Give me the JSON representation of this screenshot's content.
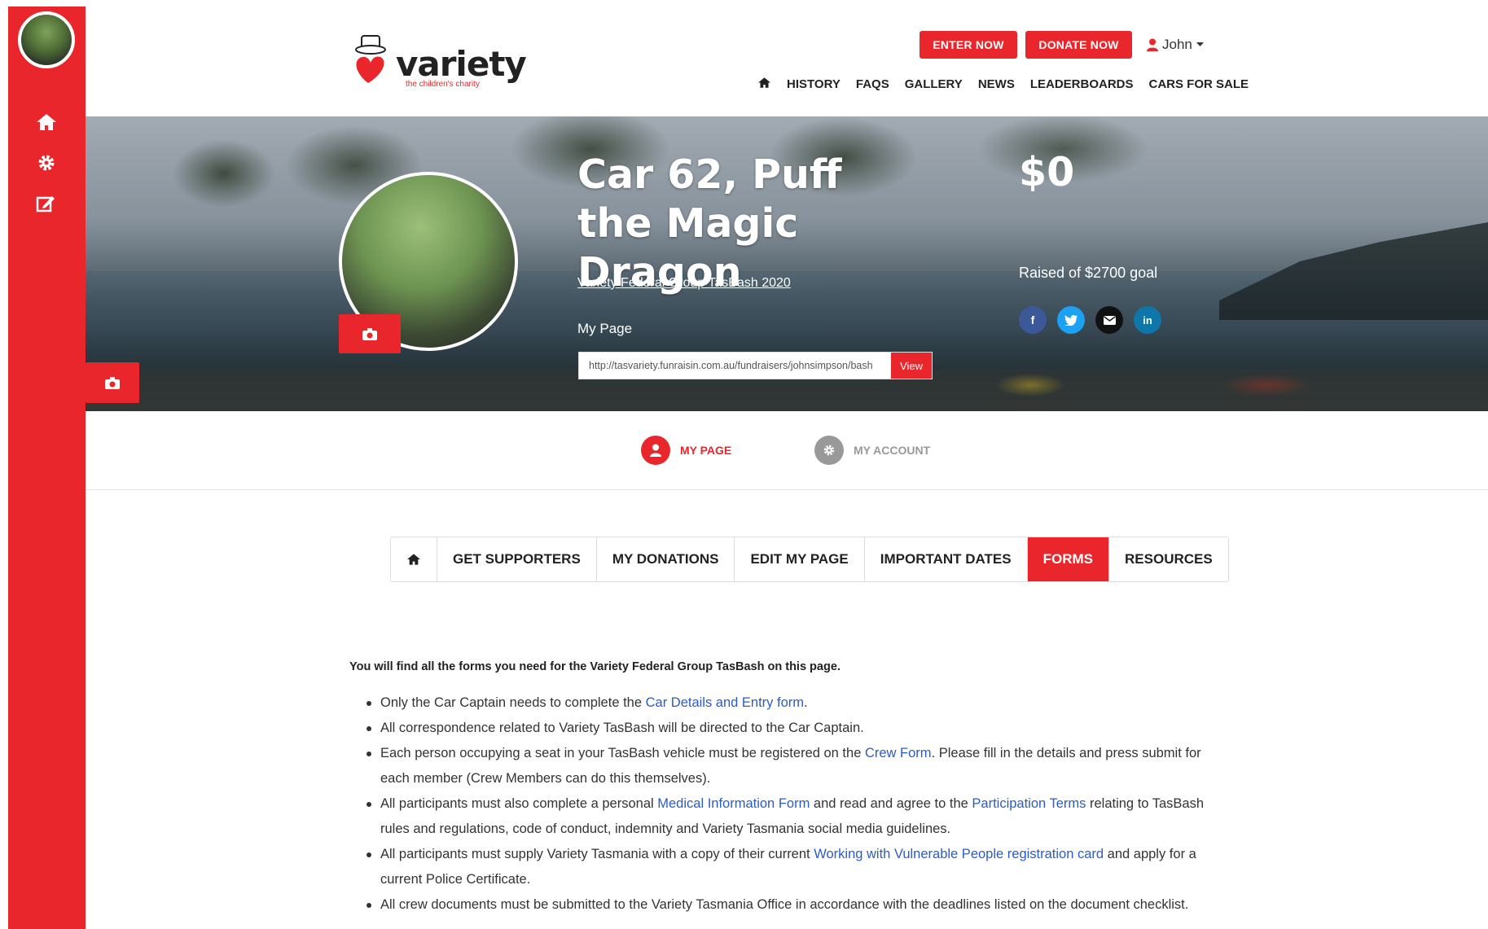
{
  "header": {
    "logo_text": "variety",
    "logo_sub": "the children's charity",
    "enter_label": "ENTER NOW",
    "donate_label": "DONATE NOW",
    "user_name": "John",
    "nav": [
      "HISTORY",
      "FAQS",
      "GALLERY",
      "NEWS",
      "LEADERBOARDS",
      "CARS FOR SALE"
    ]
  },
  "hero": {
    "title": "Car 62, Puff the Magic Dragon",
    "event_link": "Variety Federal Group TasBash 2020",
    "my_page_label": "My Page",
    "page_url": "http://tasvariety.funraisin.com.au/fundraisers/johnsimpson/bash",
    "view_label": "View",
    "amount": "$0",
    "raised_text": "Raised of $2700 goal"
  },
  "account_toggle": {
    "my_page": "MY PAGE",
    "my_account": "MY ACCOUNT"
  },
  "tabs": [
    "GET SUPPORTERS",
    "MY DONATIONS",
    "EDIT MY PAGE",
    "IMPORTANT DATES",
    "FORMS",
    "RESOURCES"
  ],
  "active_tab": "FORMS",
  "content": {
    "intro": "You will find all the forms you need for the Variety Federal Group TasBash on this page.",
    "bullets": [
      {
        "pre": "Only the Car Captain needs to complete the ",
        "link": "Car Details and Entry form",
        "post": "."
      },
      {
        "pre": "All correspondence related to Variety TasBash will be directed to the Car Captain.",
        "link": "",
        "post": ""
      },
      {
        "pre": "Each person occupying a seat in your TasBash vehicle must be registered on the ",
        "link": "Crew Form",
        "post": ". Please fill in the details and press submit for each member (Crew Members can do this themselves)."
      },
      {
        "pre": "All participants must also complete a personal ",
        "link": "Medical Information Form",
        "mid": " and read and agree to the ",
        "link2": "Participation Terms",
        "post": " relating to TasBash rules and regulations, code of conduct, indemnity and Variety Tasmania social media guidelines."
      },
      {
        "pre": "All participants must supply Variety Tasmania with a copy of their current ",
        "link": "Working with Vulnerable People registration card",
        "post": " and apply for a current Police Certificate."
      },
      {
        "pre": "All crew documents must be submitted to the Variety Tasmania Office in accordance with the deadlines listed on the document checklist.",
        "link": "",
        "post": ""
      }
    ]
  },
  "colors": {
    "brand_red": "#e8262c",
    "link_blue": "#2a5cc6"
  },
  "icons": [
    "home-icon",
    "gear-icon",
    "edit-icon",
    "camera-icon",
    "user-icon",
    "facebook-icon",
    "twitter-icon",
    "email-icon",
    "linkedin-icon"
  ]
}
